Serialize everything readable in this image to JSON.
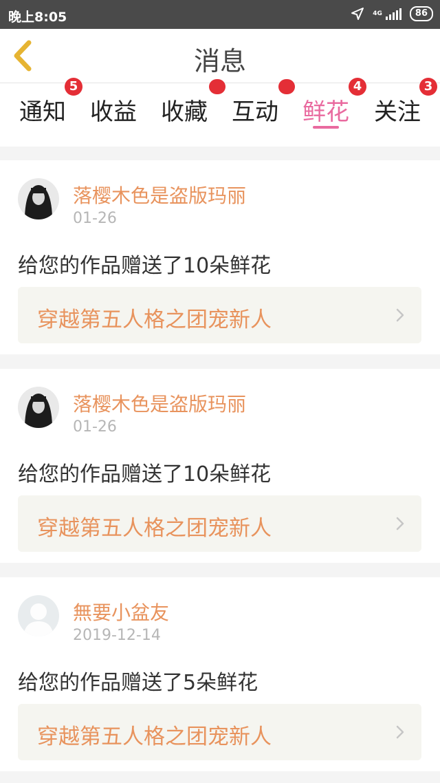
{
  "status_bar": {
    "time": "晚上8:05",
    "network": "4G",
    "battery": "86"
  },
  "header": {
    "title": "消息",
    "back_icon": "chevron-left-icon"
  },
  "tabs": [
    {
      "label": "通知",
      "badge": "5",
      "active": false
    },
    {
      "label": "收益",
      "badge": "",
      "active": false
    },
    {
      "label": "收藏",
      "badge": "",
      "badge_dot": true,
      "active": false
    },
    {
      "label": "互动",
      "badge": "",
      "badge_dot": true,
      "active": false
    },
    {
      "label": "鲜花",
      "badge": "4",
      "active": true
    },
    {
      "label": "关注",
      "badge": "3",
      "active": false
    }
  ],
  "colors": {
    "accent_pink": "#e96a9f",
    "name_orange": "#e8935d",
    "badge_red": "#e42e36"
  },
  "messages": [
    {
      "user": "落樱木色是盗版玛丽",
      "date": "01-26",
      "text": "给您的作品赠送了10朵鲜花",
      "work": "穿越第五人格之团宠新人",
      "avatar": "user-avatar-photo"
    },
    {
      "user": "落樱木色是盗版玛丽",
      "date": "01-26",
      "text": "给您的作品赠送了10朵鲜花",
      "work": "穿越第五人格之团宠新人",
      "avatar": "user-avatar-photo"
    },
    {
      "user": "無要小盆友",
      "date": "2019-12-14",
      "text": "给您的作品赠送了5朵鲜花",
      "work": "穿越第五人格之团宠新人",
      "avatar": "default-avatar-icon"
    }
  ]
}
